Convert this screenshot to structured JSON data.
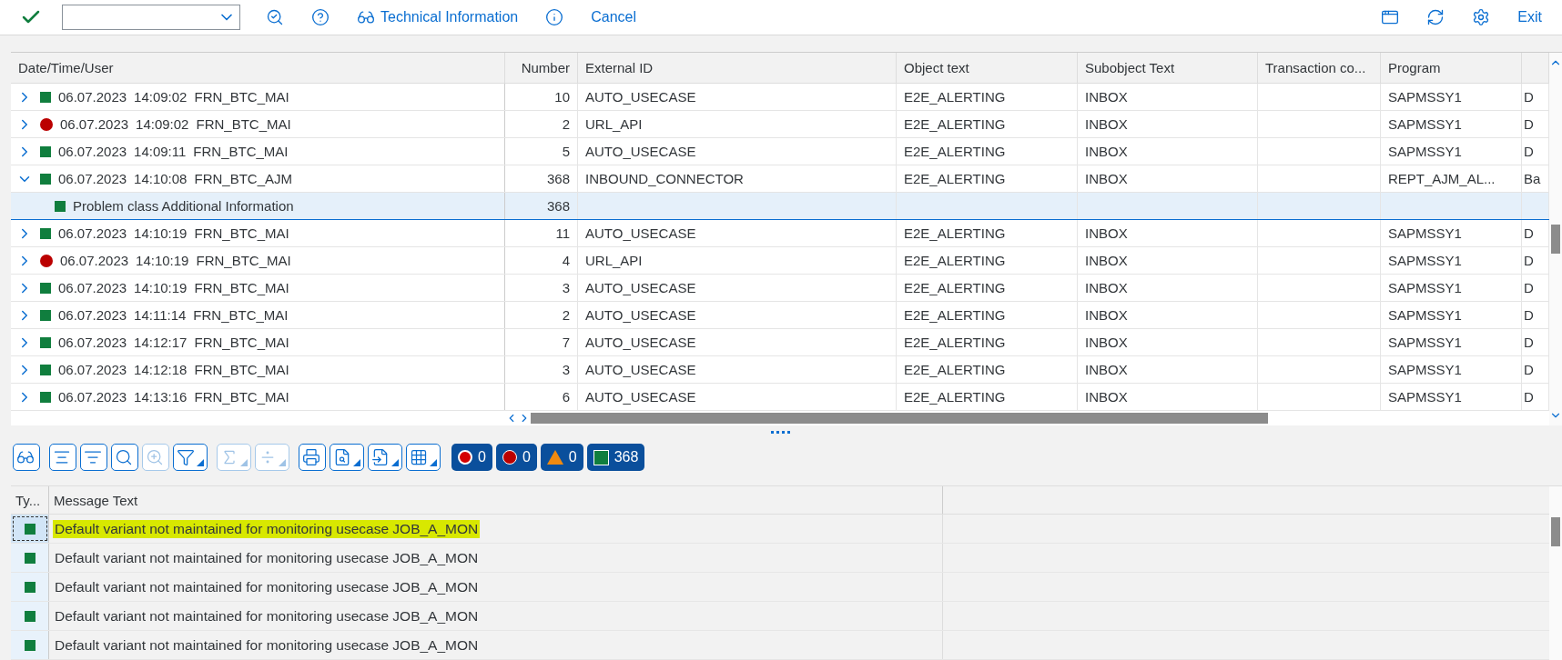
{
  "toolbar": {
    "technical_info": "Technical Information",
    "cancel": "Cancel",
    "exit": "Exit"
  },
  "log_table": {
    "columns": [
      "Date/Time/User",
      "Number",
      "External ID",
      "Object text",
      "Subobject Text",
      "Transaction co...",
      "Program"
    ],
    "rows": [
      {
        "expanded": false,
        "selected": false,
        "kind": "success",
        "date": "06.07.2023",
        "time": "14:09:02",
        "user": "FRN_BTC_MAI",
        "number": "10",
        "external_id": "AUTO_USECASE",
        "object_text": "E2E_ALERTING",
        "subobject_text": "INBOX",
        "program": "SAPMSSY1",
        "column_8": "D"
      },
      {
        "expanded": false,
        "selected": false,
        "kind": "error",
        "date": "06.07.2023",
        "time": "14:09:02",
        "user": "FRN_BTC_MAI",
        "number": "2",
        "external_id": "URL_API",
        "object_text": "E2E_ALERTING",
        "subobject_text": "INBOX",
        "program": "SAPMSSY1",
        "column_8": "D"
      },
      {
        "expanded": false,
        "selected": false,
        "kind": "success",
        "date": "06.07.2023",
        "time": "14:09:11",
        "user": "FRN_BTC_MAI",
        "number": "5",
        "external_id": "AUTO_USECASE",
        "object_text": "E2E_ALERTING",
        "subobject_text": "INBOX",
        "program": "SAPMSSY1",
        "column_8": "D"
      },
      {
        "expanded": true,
        "selected": false,
        "kind": "success",
        "date": "06.07.2023",
        "time": "14:10:08",
        "user": "FRN_BTC_AJM",
        "number": "368",
        "external_id": "INBOUND_CONNECTOR",
        "object_text": "E2E_ALERTING",
        "subobject_text": "INBOX",
        "program": "REPT_AJM_AL...",
        "column_8": "Ba",
        "children": [
          {
            "selected": true,
            "kind": "success",
            "text": "Problem class Additional Information",
            "number": "368"
          }
        ]
      },
      {
        "expanded": false,
        "selected": false,
        "kind": "success",
        "date": "06.07.2023",
        "time": "14:10:19",
        "user": "FRN_BTC_MAI",
        "number": "11",
        "external_id": "AUTO_USECASE",
        "object_text": "E2E_ALERTING",
        "subobject_text": "INBOX",
        "program": "SAPMSSY1",
        "column_8": "D"
      },
      {
        "expanded": false,
        "selected": false,
        "kind": "error",
        "date": "06.07.2023",
        "time": "14:10:19",
        "user": "FRN_BTC_MAI",
        "number": "4",
        "external_id": "URL_API",
        "object_text": "E2E_ALERTING",
        "subobject_text": "INBOX",
        "program": "SAPMSSY1",
        "column_8": "D"
      },
      {
        "expanded": false,
        "selected": false,
        "kind": "success",
        "date": "06.07.2023",
        "time": "14:10:19",
        "user": "FRN_BTC_MAI",
        "number": "3",
        "external_id": "AUTO_USECASE",
        "object_text": "E2E_ALERTING",
        "subobject_text": "INBOX",
        "program": "SAPMSSY1",
        "column_8": "D"
      },
      {
        "expanded": false,
        "selected": false,
        "kind": "success",
        "date": "06.07.2023",
        "time": "14:11:14",
        "user": "FRN_BTC_MAI",
        "number": "2",
        "external_id": "AUTO_USECASE",
        "object_text": "E2E_ALERTING",
        "subobject_text": "INBOX",
        "program": "SAPMSSY1",
        "column_8": "D"
      },
      {
        "expanded": false,
        "selected": false,
        "kind": "success",
        "date": "06.07.2023",
        "time": "14:12:17",
        "user": "FRN_BTC_MAI",
        "number": "7",
        "external_id": "AUTO_USECASE",
        "object_text": "E2E_ALERTING",
        "subobject_text": "INBOX",
        "program": "SAPMSSY1",
        "column_8": "D"
      },
      {
        "expanded": false,
        "selected": false,
        "kind": "success",
        "date": "06.07.2023",
        "time": "14:12:18",
        "user": "FRN_BTC_MAI",
        "number": "3",
        "external_id": "AUTO_USECASE",
        "object_text": "E2E_ALERTING",
        "subobject_text": "INBOX",
        "program": "SAPMSSY1",
        "column_8": "D"
      },
      {
        "expanded": false,
        "selected": false,
        "kind": "success",
        "date": "06.07.2023",
        "time": "14:13:16",
        "user": "FRN_BTC_MAI",
        "number": "6",
        "external_id": "AUTO_USECASE",
        "object_text": "E2E_ALERTING",
        "subobject_text": "INBOX",
        "program": "SAPMSSY1",
        "column_8": "D"
      }
    ]
  },
  "message_toolbar": {
    "tools": [
      {
        "kind": "details",
        "disabled": false,
        "dropdown": false
      },
      {
        "kind": "sort_up",
        "disabled": false,
        "dropdown": false
      },
      {
        "kind": "sort_down",
        "disabled": false,
        "dropdown": false
      },
      {
        "kind": "find",
        "disabled": false,
        "dropdown": false
      },
      {
        "kind": "find_next",
        "disabled": true,
        "dropdown": false
      },
      {
        "kind": "filter",
        "disabled": false,
        "dropdown": true
      },
      {
        "kind": "total",
        "disabled": true,
        "dropdown": true
      },
      {
        "kind": "subtotal",
        "disabled": true,
        "dropdown": true
      },
      {
        "kind": "print",
        "disabled": false,
        "dropdown": false
      },
      {
        "kind": "preview",
        "disabled": false,
        "dropdown": true
      },
      {
        "kind": "export",
        "disabled": false,
        "dropdown": true
      },
      {
        "kind": "layout",
        "disabled": false,
        "dropdown": true
      }
    ],
    "counters": [
      {
        "kind": "stop",
        "count": "0"
      },
      {
        "kind": "error",
        "count": "0"
      },
      {
        "kind": "warning",
        "count": "0"
      },
      {
        "kind": "success",
        "count": "368"
      }
    ]
  },
  "message_table": {
    "columns": [
      "Ty...",
      "Message Text"
    ],
    "rows": [
      {
        "selected": true,
        "kind": "success",
        "text": "Default variant not maintained for monitoring usecase JOB_A_MON"
      },
      {
        "selected": false,
        "kind": "success",
        "text": "Default variant not maintained for monitoring usecase JOB_A_MON"
      },
      {
        "selected": false,
        "kind": "success",
        "text": "Default variant not maintained for monitoring usecase JOB_A_MON"
      },
      {
        "selected": false,
        "kind": "success",
        "text": "Default variant not maintained for monitoring usecase JOB_A_MON"
      },
      {
        "selected": false,
        "kind": "success",
        "text": "Default variant not maintained for monitoring usecase JOB_A_MON"
      }
    ]
  }
}
